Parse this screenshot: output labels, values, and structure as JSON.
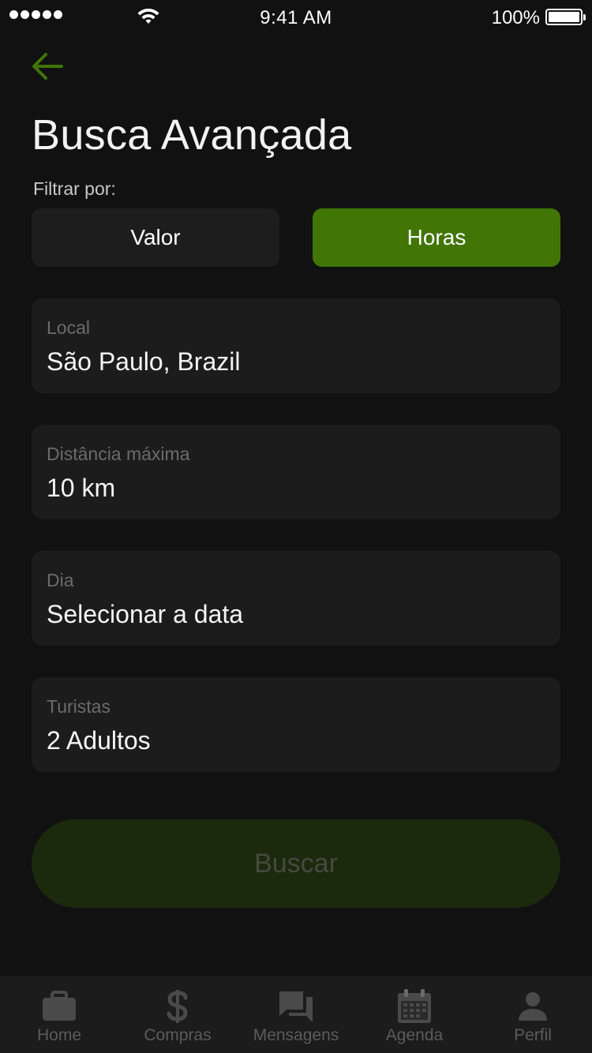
{
  "status_bar": {
    "time": "9:41 AM",
    "battery_percent": "100%",
    "signal_icon": "signal-dots-icon",
    "wifi_icon": "wifi-icon",
    "battery_icon": "battery-icon"
  },
  "header": {
    "back_icon": "arrow-left-icon",
    "title": "Busca Avançada"
  },
  "filter": {
    "label": "Filtrar por:",
    "options": [
      "Valor",
      "Horas"
    ],
    "selected": "Horas"
  },
  "fields": {
    "local": {
      "label": "Local",
      "value": "São Paulo, Brazil"
    },
    "distancia": {
      "label": "Distância máxima",
      "value": "10 km"
    },
    "dia": {
      "label": "Dia",
      "value": "Selecionar a data"
    },
    "turistas": {
      "label": "Turistas",
      "value": "2 Adultos"
    }
  },
  "search_button": {
    "label": "Buscar"
  },
  "tab_bar": {
    "items": [
      {
        "label": "Home",
        "icon": "briefcase-icon"
      },
      {
        "label": "Compras",
        "icon": "dollar-icon"
      },
      {
        "label": "Mensagens",
        "icon": "chat-icon"
      },
      {
        "label": "Agenda",
        "icon": "calendar-icon"
      },
      {
        "label": "Perfil",
        "icon": "person-icon"
      }
    ]
  },
  "colors": {
    "background": "#111111",
    "accent": "#417505",
    "field_bg": "#1c1c1c",
    "button_disabled": "#1b2a0d"
  }
}
